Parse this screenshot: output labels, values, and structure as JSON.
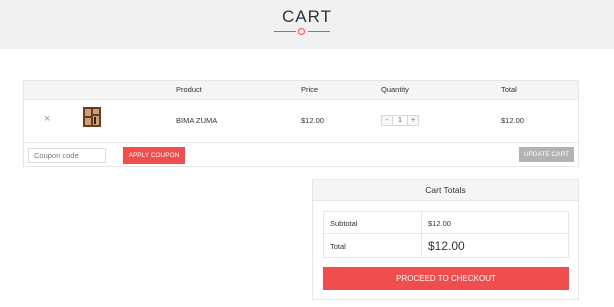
{
  "header": {
    "title": "CART"
  },
  "cart": {
    "columns": {
      "product": "Product",
      "price": "Price",
      "quantity": "Quantity",
      "total": "Total"
    },
    "items": [
      {
        "remove_icon": "×",
        "name": "BIMA ZUMA",
        "price": "$12.00",
        "quantity": "1",
        "total": "$12.00",
        "thumb_icon": "bookshelf-icon"
      }
    ],
    "qty_minus": "-",
    "qty_plus": "+",
    "coupon": {
      "placeholder": "Coupon code",
      "value": ""
    },
    "apply_label": "APPLY COUPON",
    "update_label": "UPDATE CART"
  },
  "totals": {
    "title": "Cart Totals",
    "subtotal_label": "Subtotal",
    "subtotal_value": "$12.00",
    "total_label": "Total",
    "total_value": "$12.00",
    "checkout_label": "PROCEED TO CHECKOUT"
  },
  "colors": {
    "accent": "#f04e4e",
    "muted_button": "#b3b3b3",
    "header_bg": "#f1f1f1",
    "table_head_bg": "#f5f5f5"
  }
}
